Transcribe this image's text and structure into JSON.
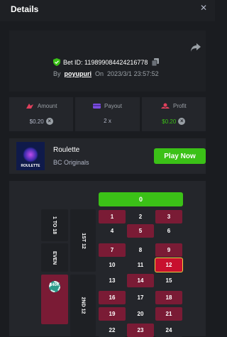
{
  "header": {
    "title": "Details",
    "close_icon": "close-icon"
  },
  "bet": {
    "id_text": "Bet ID: 119899084424216778",
    "by_label": "By",
    "username": "poyupuri",
    "on_label": "On",
    "datetime": "2023/3/1 23:57:52"
  },
  "stats": {
    "amount_label": "Amount",
    "amount_value": "$0.20",
    "payout_label": "Payout",
    "payout_value": "2 x",
    "profit_label": "Profit",
    "profit_value": "$0.20"
  },
  "game": {
    "name": "Roulette",
    "provider": "BC Originals",
    "thumb_label": "ROULETTE",
    "play_label": "Play Now"
  },
  "roulette": {
    "zero": "0",
    "side_labels": {
      "dozen1": "1ST 12",
      "dozen2": "2ND 12",
      "low": "1 TO 18",
      "even": "EVEN"
    },
    "chip_amount": "$40K",
    "numbers": [
      "1",
      "2",
      "3",
      "4",
      "5",
      "6",
      "7",
      "8",
      "9",
      "10",
      "11",
      "12",
      "13",
      "14",
      "15",
      "16",
      "17",
      "18",
      "19",
      "20",
      "21",
      "22",
      "23",
      "24"
    ],
    "winning_number": "12"
  },
  "colors": {
    "accent_green": "#3bc117",
    "red_cell": "#7a1b35",
    "win_cell": "#c8102e"
  }
}
